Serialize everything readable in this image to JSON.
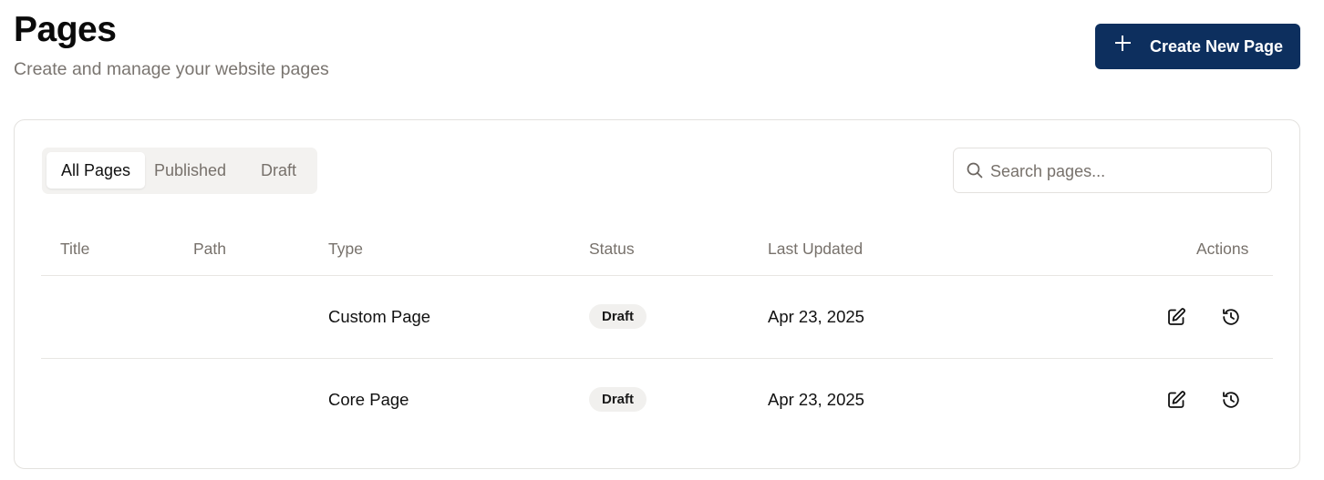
{
  "header": {
    "title": "Pages",
    "subtitle": "Create and manage your website pages",
    "create_button_label": "Create New Page"
  },
  "tabs": [
    {
      "label": "All Pages",
      "active": true
    },
    {
      "label": "Published",
      "active": false
    },
    {
      "label": "Draft",
      "active": false
    }
  ],
  "search": {
    "placeholder": "Search pages...",
    "value": ""
  },
  "table": {
    "columns": [
      "Title",
      "Path",
      "Type",
      "Status",
      "Last Updated",
      "Actions"
    ],
    "rows": [
      {
        "title": "",
        "path": "",
        "type": "Custom Page",
        "status": "Draft",
        "last_updated": "Apr 23, 2025",
        "actions": [
          "edit-icon",
          "history-icon"
        ]
      },
      {
        "title": "",
        "path": "",
        "type": "Core Page",
        "status": "Draft",
        "last_updated": "Apr 23, 2025",
        "actions": [
          "edit-icon",
          "history-icon"
        ]
      }
    ]
  },
  "colors": {
    "primary": "#0d2f5e",
    "muted_text": "#77716b",
    "badge_bg": "#f1f0ee",
    "border": "#e3e1de"
  }
}
